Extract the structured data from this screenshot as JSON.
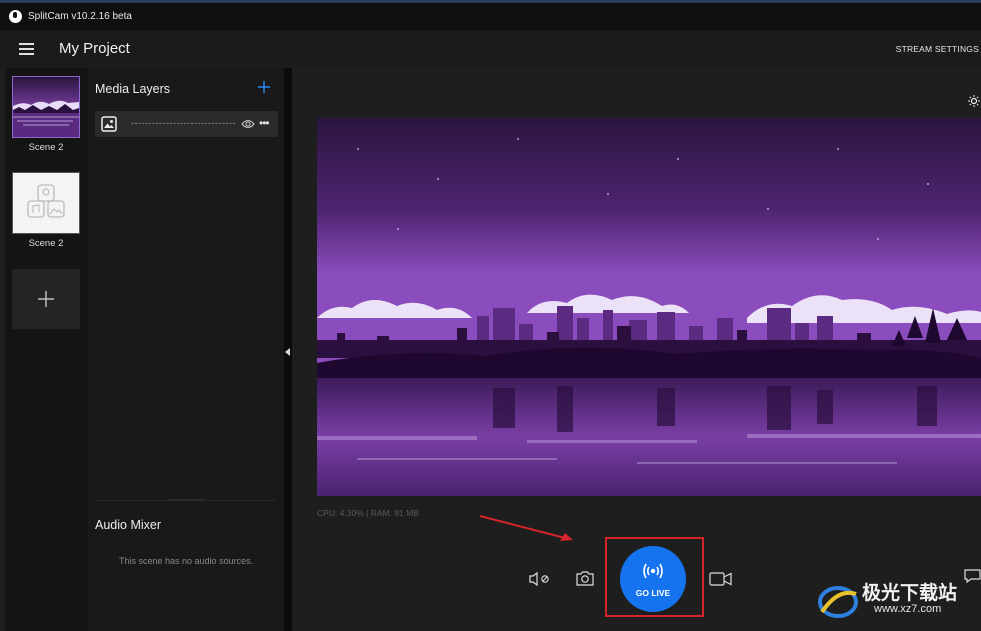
{
  "window": {
    "title": "SplitCam v10.2.16 beta"
  },
  "header": {
    "project_title": "My Project",
    "stream_settings": "STREAM SETTINGS"
  },
  "scenes": [
    {
      "label": "Scene 2",
      "active": true
    },
    {
      "label": "Scene 2",
      "active": false
    }
  ],
  "media_layers": {
    "title": "Media Layers",
    "items": [
      {
        "name": "------------------------------"
      }
    ]
  },
  "audio_mixer": {
    "title": "Audio Mixer",
    "empty_text": "This scene has no audio sources."
  },
  "stats": "CPU: 4.30% | RAM: 91 MB",
  "controls": {
    "go_live": "GO LIVE"
  },
  "watermark": {
    "text": "极光下载站",
    "url": "www.xz7.com"
  },
  "colors": {
    "accent": "#1673f0",
    "highlight": "#d5252a",
    "scene_purple": "#6a2c8e"
  },
  "icons": [
    "menu-icon",
    "plus-icon",
    "image-layer-icon",
    "eye-icon",
    "more-icon",
    "brightness-icon",
    "mute-mic-icon",
    "camera-snapshot-icon",
    "broadcast-icon",
    "video-camera-icon",
    "chat-icon"
  ]
}
